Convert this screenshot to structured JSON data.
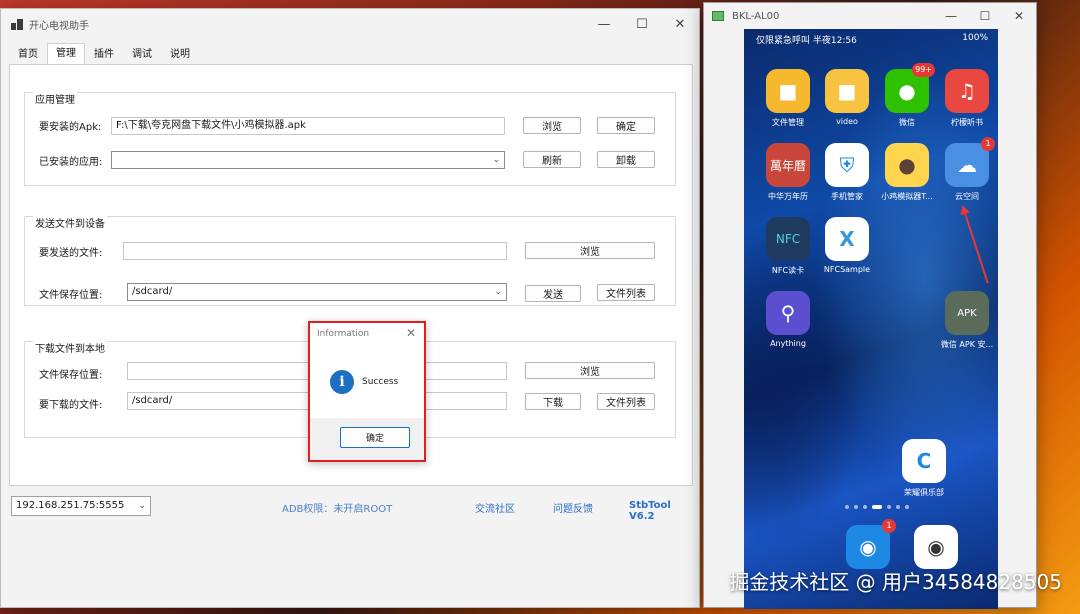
{
  "main_window": {
    "title": "开心电视助手",
    "tabs": [
      "首页",
      "管理",
      "插件",
      "调试",
      "说明"
    ]
  },
  "app_mgmt": {
    "title": "应用管理",
    "apk_label": "要安装的Apk:",
    "apk_value": "F:\\下载\\夸克网盘下载文件\\小鸡模拟器.apk",
    "browse": "浏览",
    "confirm": "确定",
    "installed_label": "已安装的应用:",
    "installed_value": "",
    "refresh": "刷新",
    "uninstall": "卸载"
  },
  "send_file": {
    "title": "发送文件到设备",
    "file_label": "要发送的文件:",
    "file_value": "",
    "browse": "浏览",
    "save_label": "文件保存位置:",
    "save_value": "/sdcard/",
    "send": "发送",
    "file_list": "文件列表"
  },
  "download_file": {
    "title": "下载文件到本地",
    "save_label": "文件保存位置:",
    "save_value": "",
    "browse": "浏览",
    "file_label": "要下载的文件:",
    "file_value": "/sdcard/",
    "download": "下载",
    "file_list": "文件列表"
  },
  "status_bar": {
    "device": "192.168.251.75:5555",
    "adb": "ADB权限：未开启ROOT",
    "community": "交流社区",
    "feedback": "问题反馈",
    "version": "StbTool V6.2"
  },
  "dialog": {
    "title": "Information",
    "message": "Success",
    "ok": "确定"
  },
  "phone_window": {
    "title": "BKL-AL00",
    "status_left": "仅限紧急呼叫 半夜12:56",
    "status_right": "100%",
    "apps": [
      {
        "label": "文件管理",
        "badge": ""
      },
      {
        "label": "video",
        "badge": ""
      },
      {
        "label": "微信",
        "badge": "99+"
      },
      {
        "label": "柠檬听书",
        "badge": ""
      },
      {
        "label": "中华万年历",
        "badge": ""
      },
      {
        "label": "手机管家",
        "badge": ""
      },
      {
        "label": "小鸡模拟器T...",
        "badge": ""
      },
      {
        "label": "云空间",
        "badge": "1"
      },
      {
        "label": "NFC读卡",
        "badge": ""
      },
      {
        "label": "NFCSample",
        "badge": ""
      },
      {
        "label": "Anything",
        "badge": ""
      },
      {
        "label": "微信 APK 安...",
        "badge": ""
      },
      {
        "label": "荣耀俱乐部",
        "badge": ""
      }
    ],
    "dock_badge": "1"
  },
  "watermark": "掘金技术社区 @ 用户34584828505",
  "colors": {
    "accent": "#1e6fc2",
    "highlight_border": "#e02020",
    "link": "#2a6fc9"
  }
}
